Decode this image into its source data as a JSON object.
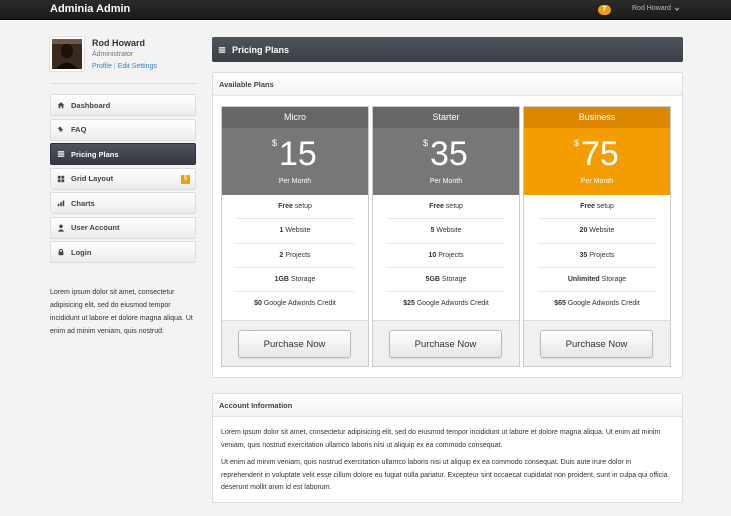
{
  "app": {
    "brand": "Adminia Admin",
    "notifications": "7",
    "user_menu": "Rod Howard"
  },
  "profile": {
    "name": "Rod Howard",
    "role": "Administrator",
    "link_profile": "Profile",
    "link_edit": "Edit Settings"
  },
  "nav": [
    {
      "label": "Dashboard",
      "icon": "home-icon"
    },
    {
      "label": "FAQ",
      "icon": "pushpin-icon"
    },
    {
      "label": "Pricing Plans",
      "icon": "list-icon",
      "active": true
    },
    {
      "label": "Grid Layout",
      "icon": "grid-icon",
      "badge": "5"
    },
    {
      "label": "Charts",
      "icon": "bar-chart-icon"
    },
    {
      "label": "User Account",
      "icon": "user-icon"
    },
    {
      "label": "Login",
      "icon": "lock-icon"
    }
  ],
  "sidebar_text": "Lorem ipsum dolor sit amet, consectetur adipisicing elit, sed do eiusmod tempor incididunt ut labore et dolore magna aliqua. Ut enim ad minim veniam, quis nostrud.",
  "page_title": "Pricing Plans",
  "plans_panel": {
    "title": "Available Plans",
    "plans": [
      {
        "name": "Micro",
        "currency": "$",
        "price": "15",
        "period": "Per Month",
        "features": [
          [
            "Free",
            " setup"
          ],
          [
            "1",
            " Website"
          ],
          [
            "2",
            " Projects"
          ],
          [
            "1GB",
            " Storage"
          ],
          [
            "$0",
            " Google Adwords Credit"
          ]
        ],
        "button": "Purchase Now"
      },
      {
        "name": "Starter",
        "currency": "$",
        "price": "35",
        "period": "Per Month",
        "features": [
          [
            "Free",
            " setup"
          ],
          [
            "5",
            " Website"
          ],
          [
            "10",
            " Projects"
          ],
          [
            "5GB",
            " Storage"
          ],
          [
            "$25",
            " Google Adwords Credit"
          ]
        ],
        "button": "Purchase Now"
      },
      {
        "name": "Business",
        "currency": "$",
        "price": "75",
        "period": "Per Month",
        "featured": true,
        "features": [
          [
            "Free",
            " setup"
          ],
          [
            "20",
            " Website"
          ],
          [
            "35",
            " Projects"
          ],
          [
            "Unlimited",
            " Storage"
          ],
          [
            "$65",
            " Google Adwords Credit"
          ]
        ],
        "button": "Purchase Now"
      }
    ]
  },
  "account_panel": {
    "title": "Account Information",
    "paragraphs": [
      "Lorem ipsum dolor sit amet, consectetur adipisicing elit, sed do eiusmod tempor incididunt ut labore et dolore magna aliqua. Ut enim ad minim veniam, quis nostrud exercitation ullamco laboris nisi ut aliquip ex ea commodo consequat.",
      "Ut enim ad minim veniam, quis nostrud exercitation ullamco laboris nisi ut aliquip ex ea commodo consequat. Duis aute irure dolor in reprehenderit in voluptate velit esse cillum dolore eu fugiat nulla pariatur. Excepteur sint occaecat cupidatat non proident, sunt in culpa qui officia deserunt mollit anim id est laborum."
    ]
  },
  "colors": {
    "accent": "#f49d00",
    "accent_dark": "#dd8700",
    "header_dark": "#3a3e45",
    "link": "#3a80c5"
  }
}
